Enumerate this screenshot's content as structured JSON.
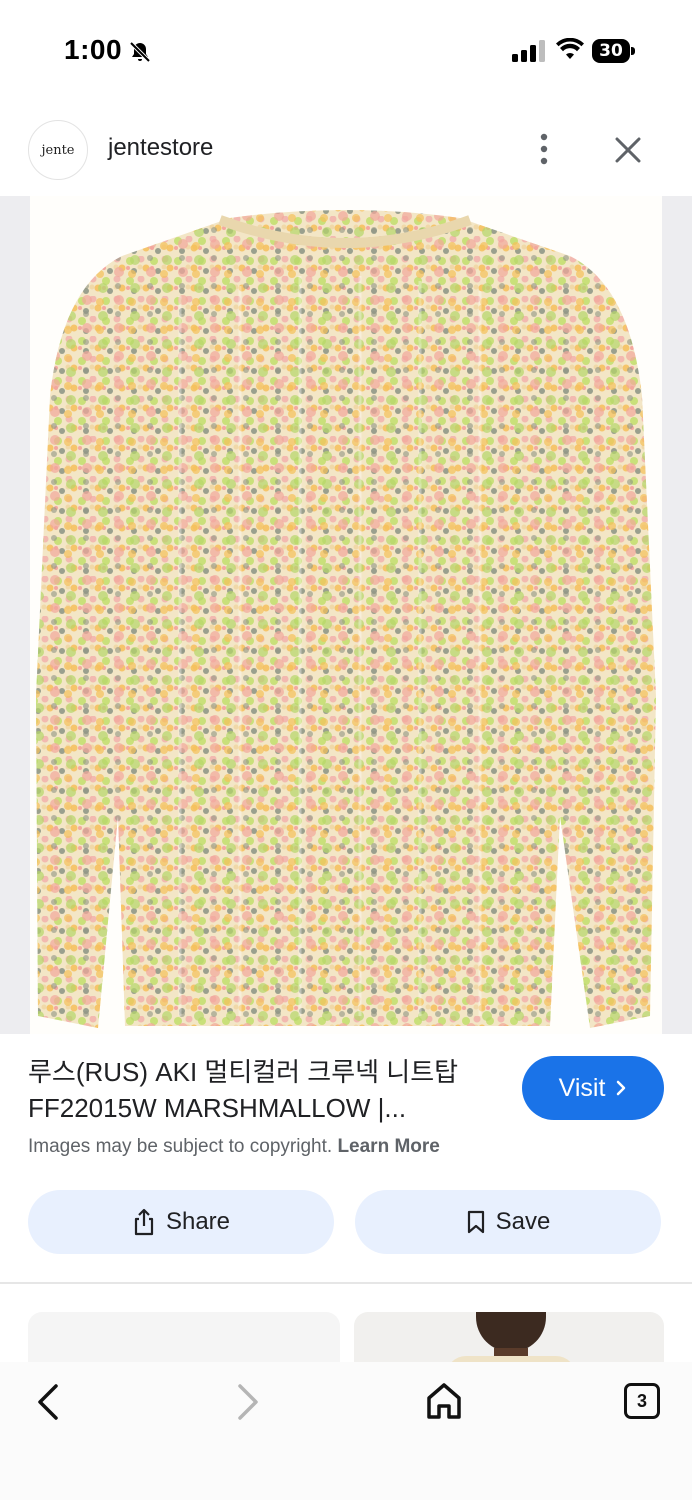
{
  "status_bar": {
    "time": "1:00",
    "battery_level": "30",
    "icons": [
      "bell-slash-icon",
      "signal-icon",
      "wifi-icon",
      "battery-icon"
    ]
  },
  "header": {
    "logo_text": "jente",
    "store_name": "jentestore",
    "icons": [
      "more-vert-icon",
      "close-icon"
    ]
  },
  "image": {
    "subject": "multicolor knit crewneck sweater"
  },
  "caption": {
    "line1": "루스(RUS) AKI 멀티컬러 크루넥 니트탑",
    "line2": "FF22015W MARSHMALLOW |..."
  },
  "visit_button": {
    "label": "Visit",
    "icon": "chevron-right-icon"
  },
  "copyright": {
    "text": "Images may be subject to copyright.",
    "link": "Learn More"
  },
  "actions": {
    "share_label": "Share",
    "save_label": "Save"
  },
  "bottom_nav": {
    "tab_count": "3",
    "icons": [
      "back-icon",
      "forward-icon",
      "home-icon",
      "tabs-icon"
    ]
  },
  "colors": {
    "accent": "#1a73e8",
    "pill_bg": "#e8f0fe",
    "text": "#202124",
    "muted": "#5f6368"
  }
}
